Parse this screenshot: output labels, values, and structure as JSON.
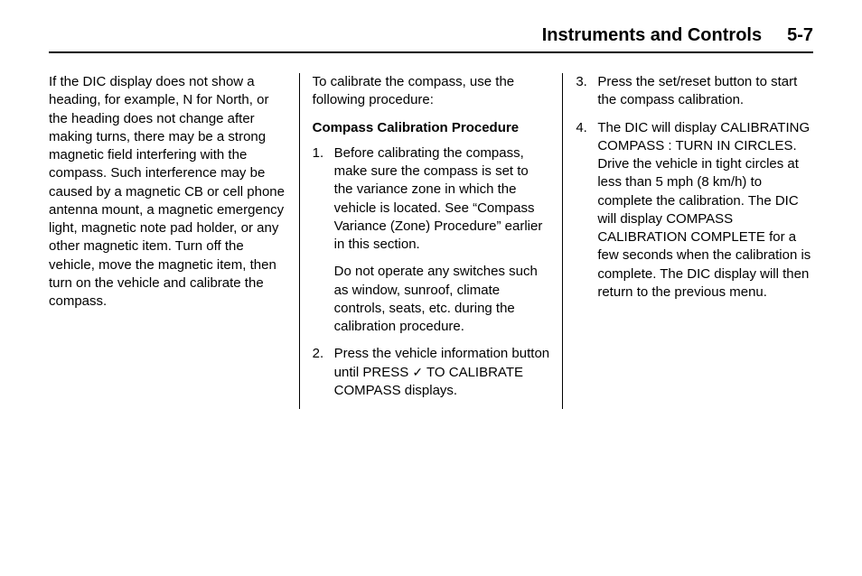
{
  "header": {
    "title": "Instruments and Controls",
    "page": "5-7"
  },
  "col1": {
    "p1": "If the DIC display does not show a heading, for example, N for North, or the heading does not change after making turns, there may be a strong magnetic field interfering with the compass. Such interference may be caused by a magnetic CB or cell phone antenna mount, a magnetic emergency light, magnetic note pad holder, or any other magnetic item. Turn off the vehicle, move the magnetic item, then turn on the vehicle and calibrate the compass."
  },
  "col2": {
    "intro": "To calibrate the compass, use the following procedure:",
    "subhead": "Compass Calibration Procedure",
    "step1_num": "1.",
    "step1": "Before calibrating the compass, make sure the compass is set to the variance zone in which the vehicle is located. See “Compass Variance (Zone) Procedure” earlier in this section.",
    "step1_note": "Do not operate any switches such as window, sunroof, climate controls, seats, etc. during the calibration procedure.",
    "step2_num": "2.",
    "step2_a": "Press the vehicle information button until PRESS ",
    "step2_b": " TO CALIBRATE COMPASS displays."
  },
  "col3": {
    "step3_num": "3.",
    "step3": "Press the set/reset button to start the compass calibration.",
    "step4_num": "4.",
    "step4": "The DIC will display CALIBRATING COMPASS : TURN IN CIRCLES. Drive the vehicle in tight circles at less than 5 mph (8 km/h) to complete the calibration. The DIC will display COMPASS CALIBRATION COMPLETE for a few seconds when the calibration is complete. The DIC display will then return to the previous menu."
  }
}
